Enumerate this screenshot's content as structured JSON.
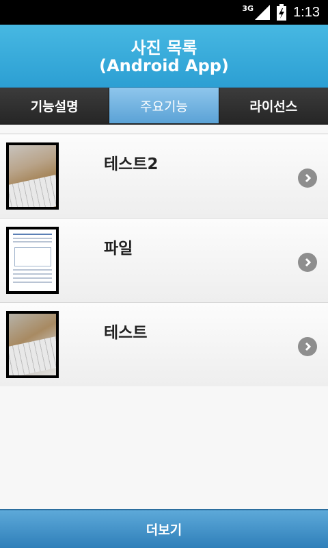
{
  "status_bar": {
    "network": "3G",
    "time": "1:13"
  },
  "header": {
    "title_line1": "사진 목록",
    "title_line2": "(Android App)"
  },
  "tabs": [
    {
      "label": "기능설명",
      "active": false
    },
    {
      "label": "주요기능",
      "active": true
    },
    {
      "label": "라이선스",
      "active": false
    }
  ],
  "items": [
    {
      "title": "테스트2",
      "thumbnail": "photo-thumbnail"
    },
    {
      "title": "파일",
      "thumbnail": "document-thumbnail"
    },
    {
      "title": "테스트",
      "thumbnail": "photo-thumbnail"
    }
  ],
  "footer": {
    "more_label": "더보기"
  },
  "icons": {
    "row_action": "chevron-right-circle-icon",
    "signal": "signal-icon",
    "battery": "battery-icon"
  },
  "colors": {
    "header": "#3aaddb",
    "active_tab": "#6eb0de",
    "footer": "#3a8cc8"
  }
}
